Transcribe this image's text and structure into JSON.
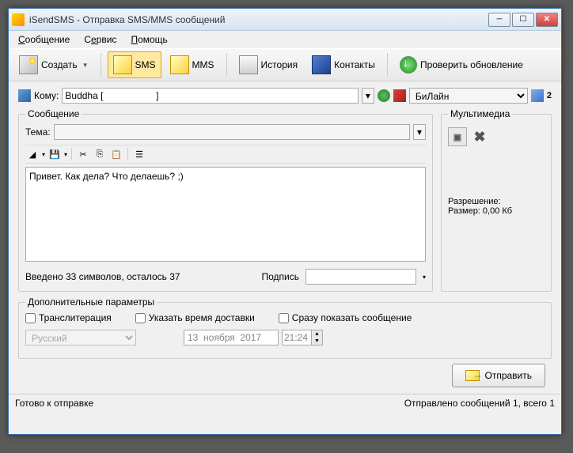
{
  "window": {
    "title": "iSendSMS - Отправка SMS/MMS сообщений"
  },
  "menu": {
    "message": "Сообщение",
    "service": "Сервис",
    "help": "Помощь"
  },
  "toolbar": {
    "create": "Создать",
    "sms": "SMS",
    "mms": "MMS",
    "history": "История",
    "contacts": "Контакты",
    "update": "Проверить обновление"
  },
  "recipient": {
    "label": "Кому:",
    "value": "Buddha [                    ]",
    "operator": "БиЛайн",
    "count": "2"
  },
  "message": {
    "legend": "Сообщение",
    "subject_label": "Тема:",
    "subject_value": "",
    "text": "Привет. Как дела? Что делаешь? ;)",
    "counter": "Введено 33 символов, осталось 37",
    "signature_label": "Подпись",
    "signature_value": ""
  },
  "multimedia": {
    "legend": "Мультимедиа",
    "resolution_label": "Разрешение:",
    "size_label": "Размер: 0,00 Кб"
  },
  "params": {
    "legend": "Дополнительные параметры",
    "translit": "Транслитерация",
    "delivery_time": "Указать время доставки",
    "show_now": "Сразу показать сообщение",
    "language": "Русский",
    "date": "13  ноября  2017",
    "time": "21:24"
  },
  "actions": {
    "send": "Отправить"
  },
  "status": {
    "left": "Готово к отправке",
    "right": "Отправлено сообщений 1, всего 1"
  }
}
